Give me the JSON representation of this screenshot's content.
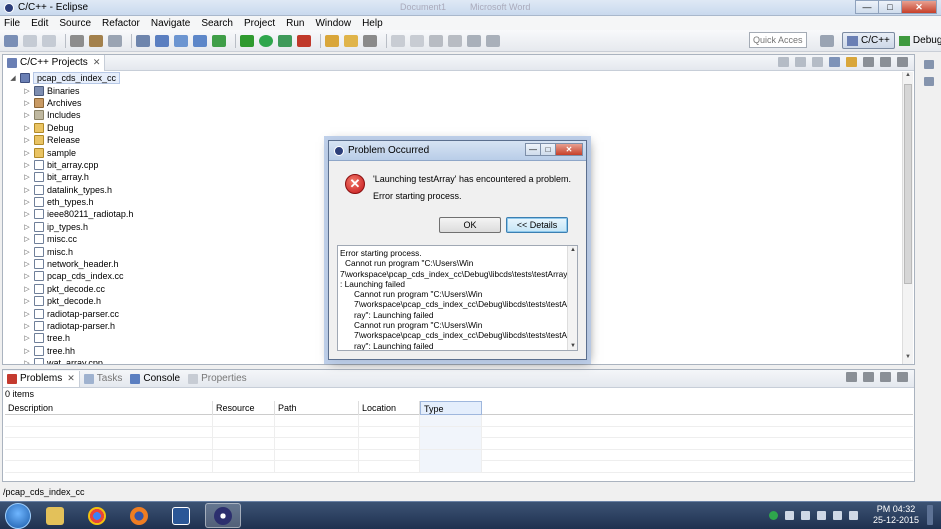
{
  "window": {
    "title": "C/C++ - Eclipse",
    "background_tabs": [
      "Document1",
      "Microsoft Word"
    ]
  },
  "menu": [
    "File",
    "Edit",
    "Source",
    "Refactor",
    "Navigate",
    "Search",
    "Project",
    "Run",
    "Window",
    "Help"
  ],
  "toolbar": {
    "quick_access_placeholder": "Quick Access"
  },
  "perspectives": [
    {
      "label": "C/C++",
      "active": true
    },
    {
      "label": "Debug",
      "active": false
    }
  ],
  "explorer": {
    "tab_label": "C/C++ Projects",
    "root": "pcap_cds_index_cc",
    "items": [
      {
        "label": "Binaries",
        "icon": "binaries-icon"
      },
      {
        "label": "Archives",
        "icon": "archives-icon"
      },
      {
        "label": "Includes",
        "icon": "includes-icon"
      },
      {
        "label": "Debug",
        "icon": "folder-icon"
      },
      {
        "label": "Release",
        "icon": "folder-icon"
      },
      {
        "label": "sample",
        "icon": "folder-icon"
      },
      {
        "label": "bit_array.cpp",
        "icon": "cpp-file-icon"
      },
      {
        "label": "bit_array.h",
        "icon": "header-file-icon"
      },
      {
        "label": "datalink_types.h",
        "icon": "header-file-icon"
      },
      {
        "label": "eth_types.h",
        "icon": "header-file-icon"
      },
      {
        "label": "ieee80211_radiotap.h",
        "icon": "header-file-icon"
      },
      {
        "label": "ip_types.h",
        "icon": "header-file-icon"
      },
      {
        "label": "misc.cc",
        "icon": "cpp-file-icon"
      },
      {
        "label": "misc.h",
        "icon": "header-file-icon"
      },
      {
        "label": "network_header.h",
        "icon": "header-file-icon"
      },
      {
        "label": "pcap_cds_index.cc",
        "icon": "cpp-file-icon"
      },
      {
        "label": "pkt_decode.cc",
        "icon": "cpp-file-icon"
      },
      {
        "label": "pkt_decode.h",
        "icon": "header-file-icon"
      },
      {
        "label": "radiotap-parser.cc",
        "icon": "cpp-file-icon"
      },
      {
        "label": "radiotap-parser.h",
        "icon": "header-file-icon"
      },
      {
        "label": "tree.h",
        "icon": "header-file-icon"
      },
      {
        "label": "tree.hh",
        "icon": "header-file-icon"
      },
      {
        "label": "wat_array.cpp",
        "icon": "cpp-file-icon"
      }
    ]
  },
  "dialog": {
    "title": "Problem Occurred",
    "message": "'Launching testArray' has encountered a problem.",
    "submessage": "Error starting process.",
    "ok_label": "OK",
    "details_label": "<< Details",
    "details_lines": [
      {
        "text": "Error starting process.",
        "indent": 0
      },
      {
        "text": "Cannot run program \"C:\\Users\\Win",
        "indent": 1
      },
      {
        "text": "7\\workspace\\pcap_cds_index_cc\\Debug\\libcds\\tests\\testArray\"",
        "indent": 0
      },
      {
        "text": ": Launching failed",
        "indent": 0
      },
      {
        "text": "Cannot run program \"C:\\Users\\Win",
        "indent": 2
      },
      {
        "text": "7\\workspace\\pcap_cds_index_cc\\Debug\\libcds\\tests\\testAr",
        "indent": 2
      },
      {
        "text": "ray\": Launching failed",
        "indent": 2
      },
      {
        "text": "Cannot run program \"C:\\Users\\Win",
        "indent": 2
      },
      {
        "text": "7\\workspace\\pcap_cds_index_cc\\Debug\\libcds\\tests\\testAr",
        "indent": 2
      },
      {
        "text": "ray\": Launching failed",
        "indent": 2
      }
    ]
  },
  "problems": {
    "tabs": [
      {
        "label": "Problems",
        "active": true
      },
      {
        "label": "Tasks",
        "active": false
      },
      {
        "label": "Console",
        "active": false
      },
      {
        "label": "Properties",
        "active": false
      }
    ],
    "count_label": "0 items",
    "columns": [
      "Description",
      "Resource",
      "Path",
      "Location",
      "Type"
    ]
  },
  "status": {
    "path": "/pcap_cds_index_cc"
  },
  "taskbar": {
    "time": "PM 04:32",
    "date": "25-12-2015"
  }
}
